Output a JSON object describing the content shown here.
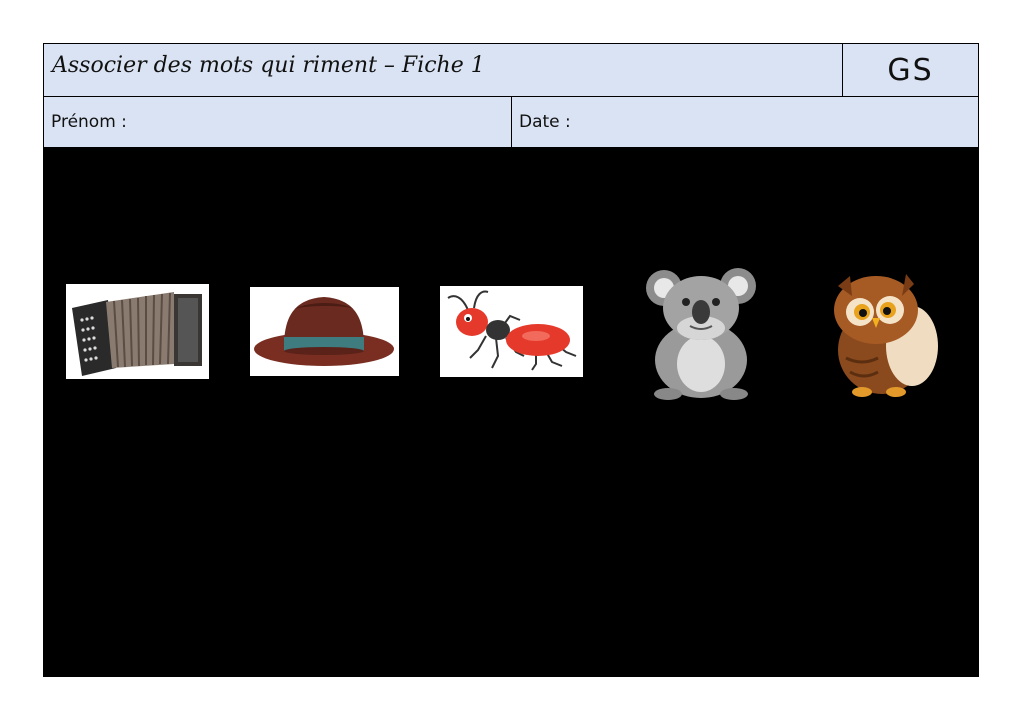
{
  "header": {
    "title": "Associer des mots qui riment – Fiche 1",
    "level": "GS"
  },
  "fields": {
    "name_label": "Prénom :",
    "date_label": "Date :"
  },
  "pictures": [
    {
      "name": "accordion-icon"
    },
    {
      "name": "hat-icon"
    },
    {
      "name": "ant-icon"
    },
    {
      "name": "koala-icon"
    },
    {
      "name": "owl-icon"
    }
  ],
  "colors": {
    "header_bg": "#dae3f3",
    "sheet_bg": "#000000",
    "border": "#000000"
  }
}
